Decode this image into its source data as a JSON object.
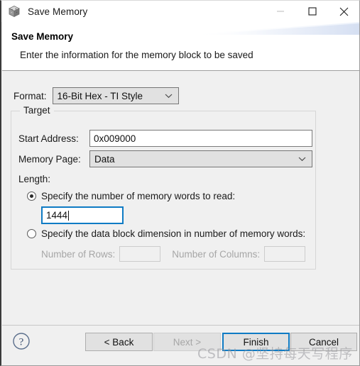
{
  "window": {
    "title": "Save Memory",
    "icon": "cube-icon",
    "controls": {
      "minimize": "minimize-icon",
      "maximize": "maximize-icon",
      "close": "close-icon"
    }
  },
  "header": {
    "title": "Save Memory",
    "subtitle": "Enter the information for the memory block to be saved"
  },
  "form": {
    "format_label": "Format:",
    "format_value": "16-Bit Hex - TI Style",
    "format_options": [
      "16-Bit Hex - TI Style"
    ],
    "group_legend": "Target",
    "start_address_label": "Start Address:",
    "start_address_value": "0x009000",
    "memory_page_label": "Memory Page:",
    "memory_page_value": "Data",
    "memory_page_options": [
      "Data"
    ],
    "length_label": "Length:",
    "radio_words_label": "Specify the number of memory words to read:",
    "radio_words_selected": true,
    "words_value": "1444",
    "radio_block_label": "Specify the data block dimension in number of memory words:",
    "radio_block_selected": false,
    "rows_label": "Number of Rows:",
    "rows_value": "",
    "columns_label": "Number of Columns:",
    "columns_value": ""
  },
  "footer": {
    "help": "help-icon",
    "back_label": "< Back",
    "next_label": "Next >",
    "finish_label": "Finish",
    "cancel_label": "Cancel"
  },
  "watermark": {
    "text": "CSDN @坚持每天写程序"
  },
  "colors": {
    "focus_blue": "#0f7bc4",
    "dialog_bg": "#f0f0f0",
    "header_bg": "#ffffff",
    "control_bg": "#e1e1e1",
    "disabled_text": "#a6a6a6"
  }
}
